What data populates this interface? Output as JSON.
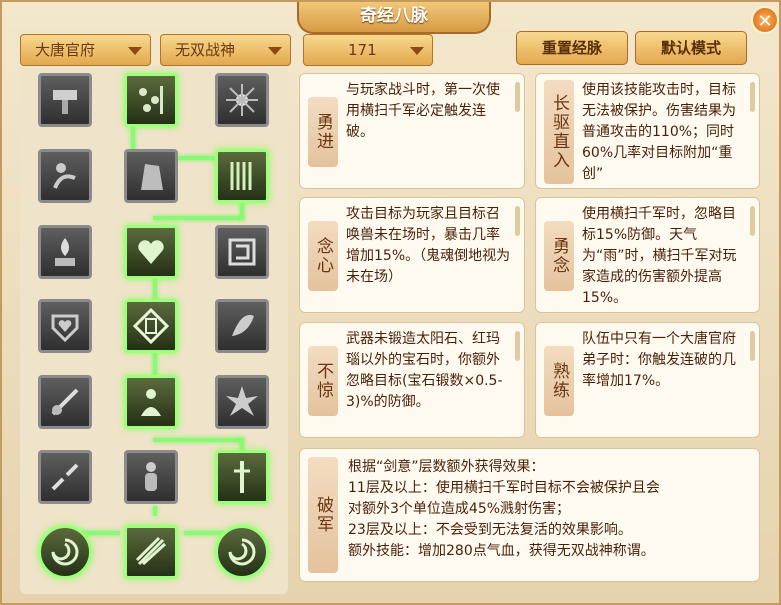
{
  "window": {
    "title": "奇经八脉",
    "close_label": "✕"
  },
  "toolbar": {
    "school": "大唐官府",
    "mode": "无双战神",
    "level": "171",
    "reset_label": "重置经脉",
    "default_label": "默认模式"
  },
  "tree": {
    "nodes": [
      {
        "icon": "hammer-icon",
        "active": false
      },
      {
        "icon": "abacus-icon",
        "active": true
      },
      {
        "icon": "sunburst-icon",
        "active": false
      },
      {
        "icon": "crouching-figure-icon",
        "active": false
      },
      {
        "icon": "stone-figure-icon",
        "active": false
      },
      {
        "icon": "bamboo-icon",
        "active": true
      },
      {
        "icon": "fire-hands-icon",
        "active": false
      },
      {
        "icon": "heart-hands-icon",
        "active": true
      },
      {
        "icon": "stamp-icon",
        "active": false
      },
      {
        "icon": "heart-shield-icon",
        "active": false
      },
      {
        "icon": "courage-glyph-icon",
        "active": true
      },
      {
        "icon": "leaf-hand-icon",
        "active": false
      },
      {
        "icon": "sword-hand-icon",
        "active": false
      },
      {
        "icon": "meditating-figure-icon",
        "active": true
      },
      {
        "icon": "explosion-icon",
        "active": false
      },
      {
        "icon": "broken-sword-icon",
        "active": false
      },
      {
        "icon": "standing-monk-icon",
        "active": false
      },
      {
        "icon": "sword-warrior-icon",
        "active": true
      },
      {
        "icon": "swirl-orb-icon",
        "active": true
      },
      {
        "icon": "crossed-blades-icon",
        "active": true
      },
      {
        "icon": "swirl-orb-icon",
        "active": true
      }
    ]
  },
  "cards": [
    {
      "label": "勇进",
      "text": "与玩家战斗时，第一次使用横扫千军必定触发连破。"
    },
    {
      "label": "长驱直入",
      "text": "使用该技能攻击时，目标无法被保护。伤害结果为普通攻击的110%；同时60%几率对目标附加“重创”"
    },
    {
      "label": "念心",
      "text": "攻击目标为玩家且目标召唤兽未在场时，暴击几率增加15%。（鬼魂倒地视为未在场）"
    },
    {
      "label": "勇念",
      "text": "使用横扫千军时，忽略目标15%防御。天气为“雨”时，横扫千军对玩家造成的伤害额外提高15%。"
    },
    {
      "label": "不惊",
      "text": "武器未锻造太阳石、红玛瑙以外的宝石时，你额外忽略目标(宝石锻数×0.5-3)%的防御。"
    },
    {
      "label": "熟练",
      "text": "队伍中只有一个大唐官府弟子时：你触发连破的几率增加17%。"
    }
  ],
  "final_card": {
    "label": "破军",
    "lines": [
      "根据“剑意”层数额外获得效果：",
      "11层及以上：使用横扫千军时目标不会被保护且会",
      "对额外3个单位造成45%溅射伤害；",
      "23层及以上：不会受到无法复活的效果影响。",
      "额外技能：增加280点气血，获得无双战神称谓。"
    ]
  }
}
